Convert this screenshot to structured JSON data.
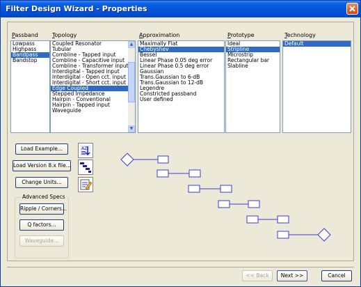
{
  "window": {
    "title": "Filter Design Wizard - Properties"
  },
  "columns": {
    "passband": {
      "label_u": "P",
      "label_rest": "assband",
      "items": [
        "Lowpass",
        "Highpass",
        "Bandpass",
        "Bandstop"
      ],
      "selected": 2
    },
    "topology": {
      "label_u": "T",
      "label_rest": "opology",
      "items": [
        "Coupled Resonator",
        "Tubular",
        "Combline - Tapped input",
        "Combline - Capacitive input",
        "Combline - Transformer input",
        "Interdigital - Tapped input",
        "Interdigital - Open cct. input",
        "Interdigital - Short cct. input",
        "Edge Coupled",
        "Stepped Impedance",
        "Hairpin - Conventional",
        "Hairpin - Tapped input",
        "Waveguide"
      ],
      "selected": 8
    },
    "approximation": {
      "label_u": "A",
      "label_rest": "pproximation",
      "items": [
        "Maximally Flat",
        "Chebyshev",
        "Bessel",
        "Linear Phase 0.05 deg error",
        "Linear Phase 0.5 deg error",
        "Gaussian",
        "Trans.Gaussian to 6-dB",
        "Trans.Gaussian to 12-dB",
        "Legendre",
        "Constricted passband",
        "User defined"
      ],
      "selected": 1
    },
    "prototype": {
      "label_u": "P",
      "label_rest": "rototype",
      "items": [
        "Ideal",
        "Stripline",
        "Microstrip",
        "Rectangular bar",
        "Slabline"
      ],
      "selected": 1
    },
    "technology": {
      "label_u": "T",
      "label_rest": "echnology",
      "items": [
        "Default"
      ],
      "selected": 0
    }
  },
  "buttons": {
    "load_example": "Load Example...",
    "load_version": "Load Version 8.x file...",
    "change_units": "Change Units...",
    "ripple": "Ripple / Corners...",
    "q_factors": "Q factors...",
    "waveguide": "Waveguide...",
    "back": "<< Back",
    "next": "Next >>",
    "cancel": "Cancel"
  },
  "advanced_specs": {
    "legend": "Advanced Specs"
  },
  "icons": {
    "close": "close-icon",
    "sort": "sort-icon",
    "staircase": "staircase-icon",
    "edit": "edit-icon"
  },
  "colors": {
    "selection": "#316ac5",
    "schematic": "#3b3bd0",
    "title_bar": "#0553da"
  }
}
